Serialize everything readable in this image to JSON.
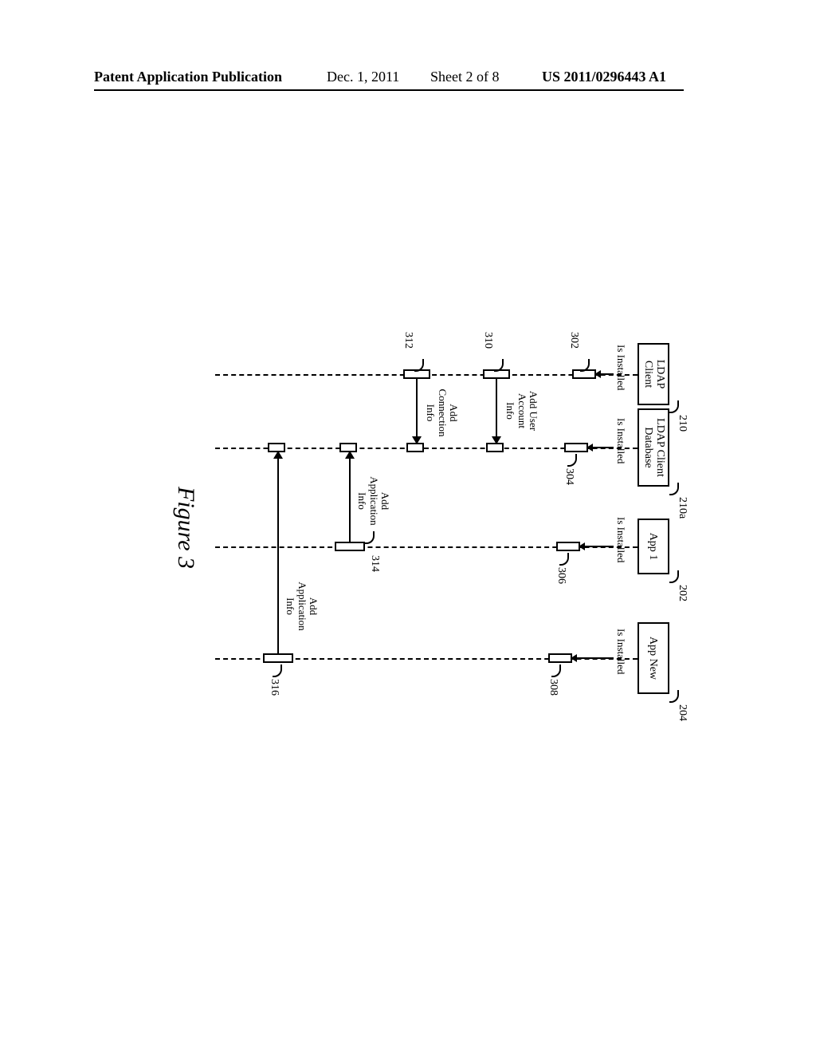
{
  "header": {
    "publication_label": "Patent Application Publication",
    "date": "Dec. 1, 2011",
    "sheet": "Sheet 2 of 8",
    "pub_number": "US 2011/0296443 A1"
  },
  "lifelines": {
    "ldap_client": {
      "label": "LDAP\nClient",
      "ref": "210"
    },
    "ldap_db": {
      "label": "LDAP Client\nDatabase",
      "ref": "210a"
    },
    "app1": {
      "label": "App 1",
      "ref": "202"
    },
    "app_new": {
      "label": "App New",
      "ref": "204"
    }
  },
  "messages": {
    "install_ldap": "Is Installed",
    "install_db": "Is Installed",
    "install_app1": "Is Installed",
    "install_appnew": "Is Installed",
    "add_user": "Add User\nAccount\nInfo",
    "add_conn": "Add\nConnection\nInfo",
    "add_app1": "Add\nApplication\nInfo",
    "add_appnew": "Add\nApplication\nInfo"
  },
  "refs": {
    "r302": "302",
    "r304": "304",
    "r306": "306",
    "r308": "308",
    "r310": "310",
    "r312": "312",
    "r314": "314",
    "r316": "316"
  },
  "figure_caption": "Figure 3"
}
